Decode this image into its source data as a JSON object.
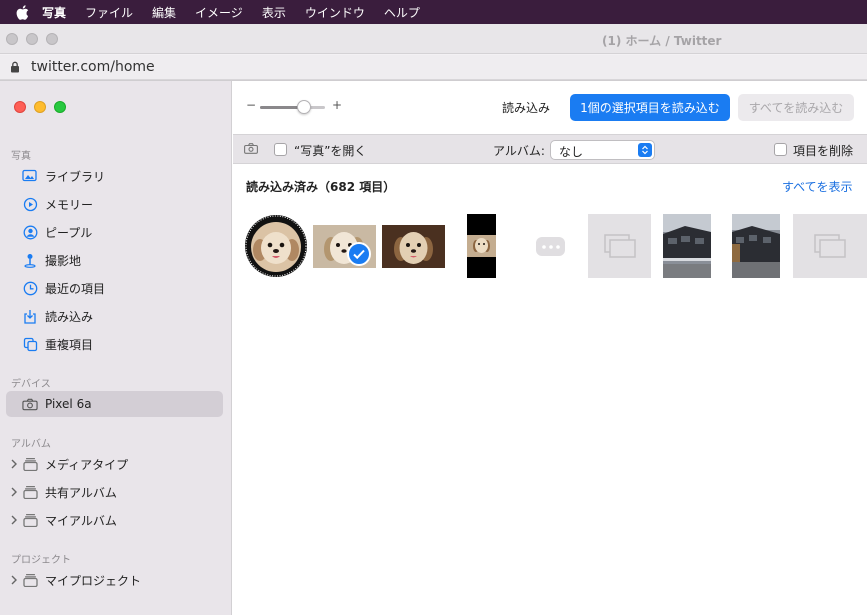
{
  "menubar": {
    "apple": "apple-icon",
    "items": [
      {
        "label": "写真",
        "bold": true
      },
      {
        "label": "ファイル"
      },
      {
        "label": "編集"
      },
      {
        "label": "イメージ"
      },
      {
        "label": "表示"
      },
      {
        "label": "ウインドウ"
      },
      {
        "label": "ヘルプ"
      }
    ]
  },
  "browser": {
    "title": "(1) ホーム / Twitter",
    "url": "twitter.com/home"
  },
  "sidebar": {
    "section_photos": "写真",
    "items": [
      {
        "label": "ライブラリ",
        "icon": "library-icon"
      },
      {
        "label": "メモリー",
        "icon": "memories-icon"
      },
      {
        "label": "ピープル",
        "icon": "people-icon"
      },
      {
        "label": "撮影地",
        "icon": "places-icon"
      },
      {
        "label": "最近の項目",
        "icon": "recents-icon"
      },
      {
        "label": "読み込み",
        "icon": "imports-icon"
      },
      {
        "label": "重複項目",
        "icon": "duplicates-icon"
      }
    ],
    "section_devices": "デバイス",
    "device": {
      "label": "Pixel 6a",
      "icon": "camera-icon"
    },
    "section_albums": "アルバム",
    "albums": [
      {
        "label": "メディアタイプ"
      },
      {
        "label": "共有アルバム"
      },
      {
        "label": "マイアルバム"
      }
    ],
    "section_projects": "プロジェクト",
    "projects": [
      {
        "label": "マイプロジェクト"
      }
    ]
  },
  "toolbar": {
    "zoom_minus": "−",
    "zoom_plus": "+",
    "zoom_level": 0.68,
    "import_label": "読み込み",
    "import_selected_label": "1個の選択項目を読み込む",
    "import_all_label": "すべてを読み込む"
  },
  "options": {
    "open_photos_label": "“写真”を開く",
    "album_label": "アルバム:",
    "album_value": "なし",
    "delete_items_label": "項目を削除"
  },
  "imported": {
    "title": "読み込み済み（682 項目）",
    "show_all": "すべてを表示"
  },
  "colors": {
    "accent": "#1a7cf2",
    "menubar": "#3a1d3d",
    "sidebar": "#e9e5ea",
    "traffic_red": "#fe5f57",
    "traffic_yellow": "#febc2e",
    "traffic_green": "#28c840"
  }
}
